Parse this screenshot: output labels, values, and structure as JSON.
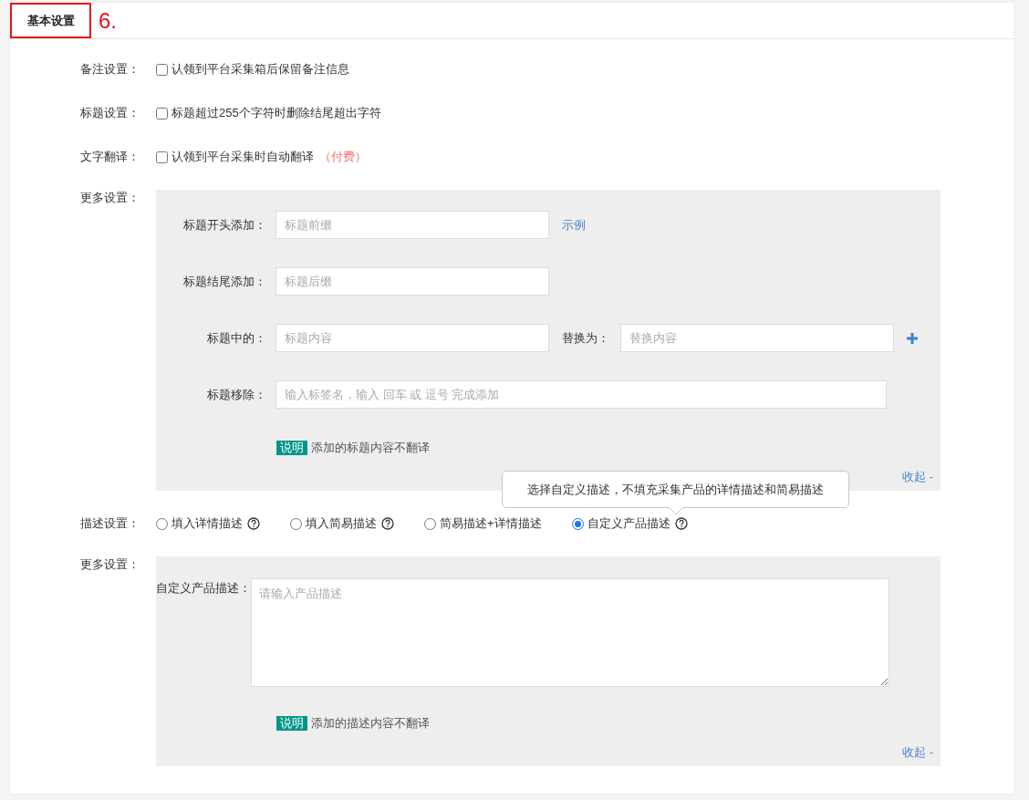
{
  "header": {
    "tab": "基本设置",
    "annotation": "6."
  },
  "options": [
    {
      "label": "备注设置：",
      "text": "认领到平台采集箱后保留备注信息",
      "checked": false
    },
    {
      "label": "标题设置：",
      "text": "标题超过255个字符时删除结尾超出字符",
      "checked": false
    },
    {
      "label": "文字翻译：",
      "text": "认领到平台采集时自动翻译",
      "note": "（付费）",
      "checked": false
    }
  ],
  "title_settings": {
    "label": "更多设置：",
    "fields": [
      {
        "kind": "prefix",
        "label": "标题开头添加：",
        "placeholder": "标题前缀",
        "link": "示例"
      },
      {
        "kind": "suffix",
        "label": "标题结尾添加：",
        "placeholder": "标题后缀"
      },
      {
        "kind": "replace",
        "label": "标题中的：",
        "placeholder": "标题内容",
        "replace_label": "替换为：",
        "replace_placeholder": "替换内容"
      },
      {
        "kind": "tags",
        "label": "标题移除：",
        "placeholder": "输入标签名，输入 回车 或 逗号 完成添加"
      }
    ],
    "note": {
      "tag": "说明",
      "text": "添加的标题内容不翻译"
    },
    "collapse": "收起 -"
  },
  "description": {
    "label": "描述设置：",
    "options": [
      {
        "text": "填入详情描述",
        "help": true,
        "selected": false
      },
      {
        "text": "填入简易描述",
        "help": true,
        "selected": false
      },
      {
        "text": "简易描述+详情描述",
        "help": false,
        "selected": false
      },
      {
        "text": "自定义产品描述",
        "help": true,
        "selected": true,
        "tooltip": "选择自定义描述，不填充采集产品的详情描述和简易描述"
      }
    ]
  },
  "description_settings": {
    "label": "更多设置：",
    "field_label": "自定义产品描述：",
    "placeholder": "请输入产品描述",
    "note": {
      "tag": "说明",
      "text": "添加的描述内容不翻译"
    },
    "collapse": "收起 -"
  }
}
